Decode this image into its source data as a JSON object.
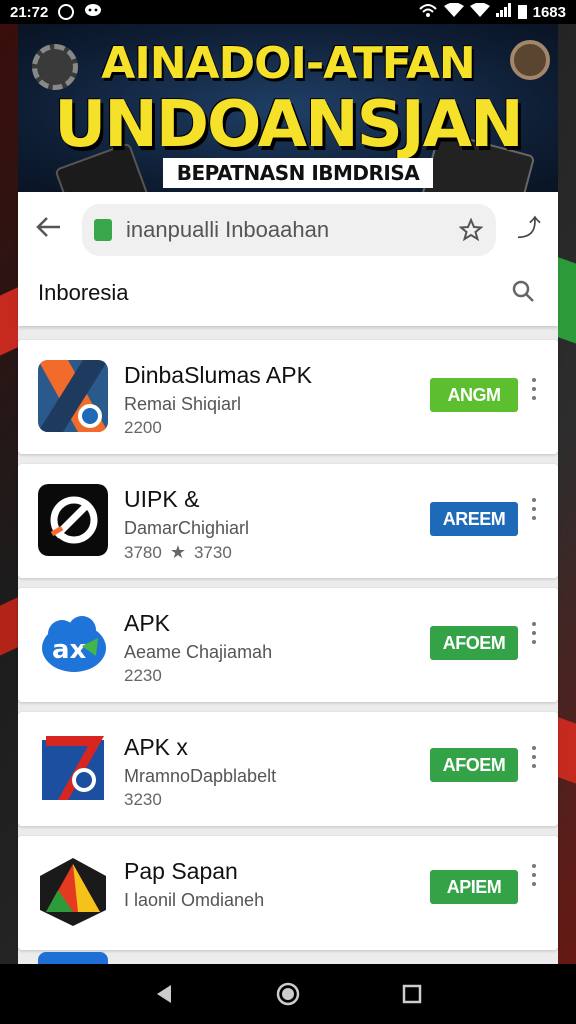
{
  "status_bar": {
    "time": "21:72",
    "battery_text": "1683"
  },
  "banner": {
    "line1": "AINADOI-ATFAN",
    "line2": "UNDOANSJAN",
    "subtitle": "BEPATNASN IBMDRISA"
  },
  "browser": {
    "url": "inanpualli Inboaahan",
    "menu_glyph": "⤴"
  },
  "search": {
    "title": "Inboresia"
  },
  "apps": [
    {
      "name": "DinbaSlumas APK",
      "developer": "Remai Shiqiarl",
      "meta": "2200",
      "rating": "",
      "button": "ANGM",
      "button_color": "#5cbf2f",
      "icon": "stylized-x-icon"
    },
    {
      "name": "UIPK  &",
      "developer": "DamarChighiarl",
      "meta": "3780",
      "rating": "3730",
      "button": "AREEM",
      "button_color": "#1e6ab8",
      "icon": "black-a-logo-icon"
    },
    {
      "name": "APK",
      "developer": "Aeame Chajiamah",
      "meta": "2230",
      "rating": "",
      "button": "AFOEM",
      "button_color": "#34a348",
      "icon": "blue-cloud-ax-icon"
    },
    {
      "name": "APK  x",
      "developer": "MramnoDapblabelt",
      "meta": "3230",
      "rating": "",
      "button": "AFOEM",
      "button_color": "#34a348",
      "icon": "red-seven-icon"
    },
    {
      "name": "Pap Sapan",
      "developer": "I laonil Omdianeh",
      "meta": "",
      "rating": "",
      "button": "APIEM",
      "button_color": "#34a348",
      "icon": "colorful-triangle-icon"
    }
  ],
  "colors": {
    "banner_yellow": "#f6e12a",
    "banner_blue": "#1f3f66"
  }
}
